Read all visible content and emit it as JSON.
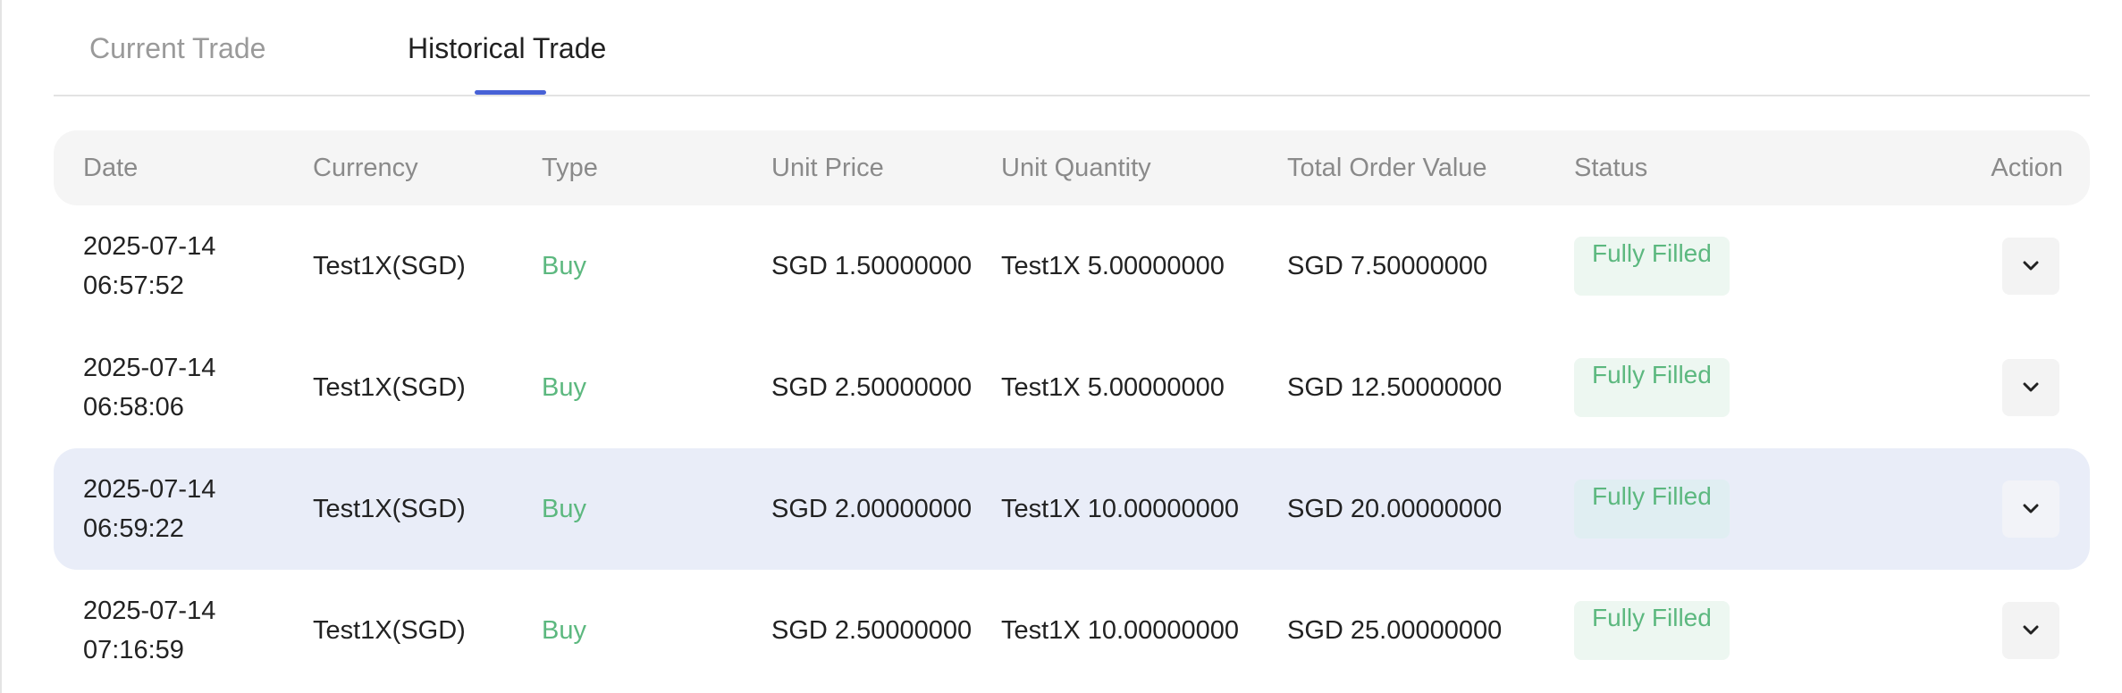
{
  "tabs": [
    {
      "label": "Current Trade",
      "active": false
    },
    {
      "label": "Historical Trade",
      "active": true
    }
  ],
  "colors": {
    "accent": "#4761d6",
    "buy": "#5cb87f",
    "status_bg": "#edf7f1",
    "row_highlight": "#e9edf8",
    "header_bg": "#f5f5f5"
  },
  "table": {
    "headers": {
      "date": "Date",
      "currency": "Currency",
      "type": "Type",
      "unit_price": "Unit Price",
      "unit_quantity": "Unit Quantity",
      "total_order_value": "Total Order Value",
      "status": "Status",
      "action": "Action"
    },
    "rows": [
      {
        "date": "2025-07-14\n06:57:52",
        "currency": "Test1X(SGD)",
        "type": "Buy",
        "unit_price": "SGD 1.50000000",
        "unit_quantity": "Test1X 5.00000000",
        "total_order_value": "SGD 7.50000000",
        "status": "Fully Filled",
        "action_icon": "chevron-down-icon",
        "highlighted": false
      },
      {
        "date": "2025-07-14\n06:58:06",
        "currency": "Test1X(SGD)",
        "type": "Buy",
        "unit_price": "SGD 2.50000000",
        "unit_quantity": "Test1X 5.00000000",
        "total_order_value": "SGD 12.50000000",
        "status": "Fully Filled",
        "action_icon": "chevron-down-icon",
        "highlighted": false
      },
      {
        "date": "2025-07-14\n06:59:22",
        "currency": "Test1X(SGD)",
        "type": "Buy",
        "unit_price": "SGD 2.00000000",
        "unit_quantity": "Test1X 10.00000000",
        "total_order_value": "SGD 20.00000000",
        "status": "Fully Filled",
        "action_icon": "chevron-down-icon",
        "highlighted": true
      },
      {
        "date": "2025-07-14\n07:16:59",
        "currency": "Test1X(SGD)",
        "type": "Buy",
        "unit_price": "SGD 2.50000000",
        "unit_quantity": "Test1X 10.00000000",
        "total_order_value": "SGD 25.00000000",
        "status": "Fully Filled",
        "action_icon": "chevron-down-icon",
        "highlighted": false
      }
    ]
  }
}
